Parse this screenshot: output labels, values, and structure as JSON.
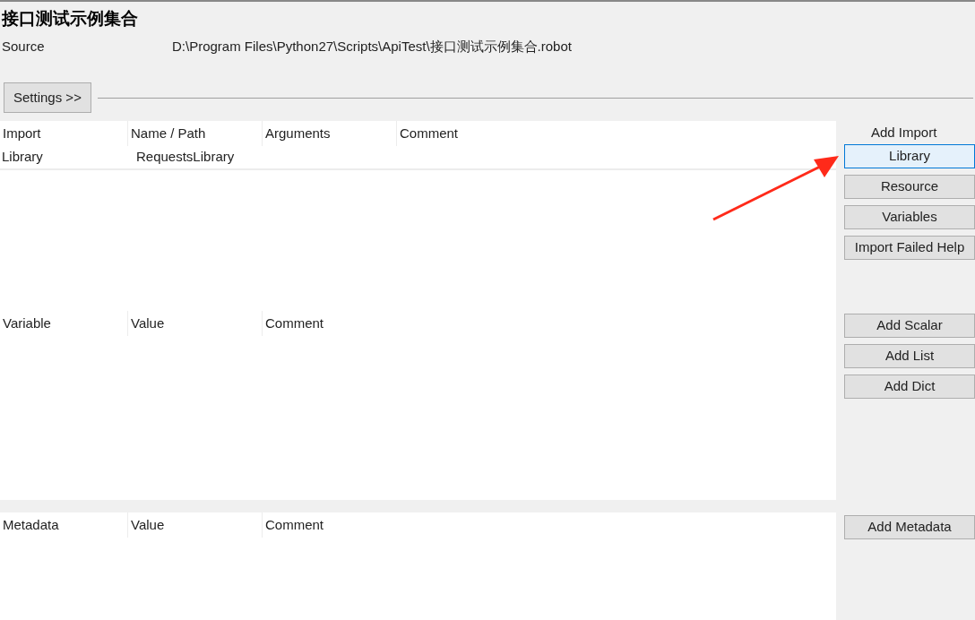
{
  "title": "接口测试示例集合",
  "source": {
    "label": "Source",
    "path": "D:\\Program Files\\Python27\\Scripts\\ApiTest\\接口测试示例集合.robot"
  },
  "settings_button": "Settings >>",
  "imports": {
    "columns": [
      "Import",
      "Name / Path",
      "Arguments",
      "Comment"
    ],
    "rows": [
      [
        "Library",
        "RequestsLibrary"
      ]
    ],
    "heading": "Add Import",
    "buttons": [
      {
        "label": "Library",
        "focused": true
      },
      {
        "label": "Resource",
        "focused": false
      },
      {
        "label": "Variables",
        "focused": false
      },
      {
        "label": "Import Failed Help",
        "focused": false
      }
    ]
  },
  "variables": {
    "columns": [
      "Variable",
      "Value",
      "Comment"
    ],
    "buttons": [
      {
        "label": "Add Scalar",
        "focused": false
      },
      {
        "label": "Add List",
        "focused": false
      },
      {
        "label": "Add Dict",
        "focused": false
      }
    ]
  },
  "metadata": {
    "columns": [
      "Metadata",
      "Value",
      "Comment"
    ],
    "buttons": [
      {
        "label": "Add Metadata",
        "focused": false
      }
    ]
  }
}
